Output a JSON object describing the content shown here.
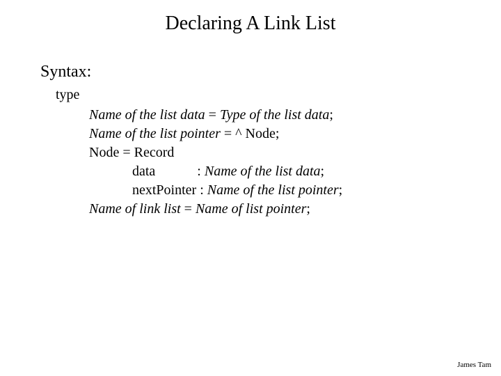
{
  "title": "Declaring A Link List",
  "syntax_label": "Syntax:",
  "type_keyword": "type",
  "lines": {
    "l1a": "Name of the list data",
    "l1b": " = ",
    "l1c": "Type of the list data",
    "l1d": ";",
    "l2a": "Name of the list pointer",
    "l2b": " = ^ Node;",
    "l3": "Node = Record",
    "l4a": "data            : ",
    "l4b": "Name of the list data",
    "l4c": ";",
    "l5a": "nextPointer : ",
    "l5b": "Name of the list pointer",
    "l5c": ";",
    "l6a": "Name of link list",
    "l6b": " = ",
    "l6c": "Name of list pointer",
    "l6d": ";"
  },
  "footer": "James Tam"
}
